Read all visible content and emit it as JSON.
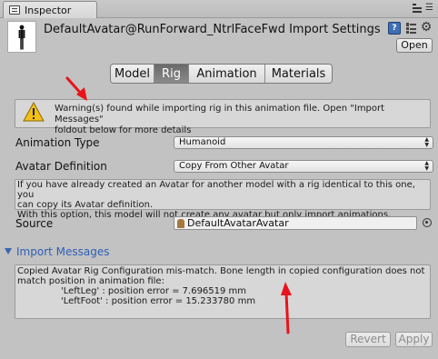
{
  "tab": {
    "title": "Inspector",
    "icon": "inspector-icon"
  },
  "header": {
    "title": "DefaultAvatar@RunForward_NtrlFaceFwd Import Settings",
    "open_label": "Open",
    "icons": [
      "help-book-icon",
      "preset-icon",
      "gear-icon"
    ]
  },
  "toolbar": {
    "tabs": [
      "Model",
      "Rig",
      "Animation",
      "Materials"
    ],
    "active_tab": "Rig"
  },
  "warning": {
    "line1": "Warning(s) found while importing rig in this animation file. Open \"Import Messages\"",
    "line2": "foldout below for more details"
  },
  "rig": {
    "animation_type_label": "Animation Type",
    "animation_type_value": "Humanoid",
    "avatar_definition_label": "Avatar Definition",
    "avatar_definition_value": "Copy From Other Avatar",
    "info_line1": "If you have already created an Avatar for another model with a rig identical to this one, you",
    "info_line2": "can copy its Avatar definition.",
    "info_line3": "With this option, this model will not create any avatar but only import animations.",
    "source_label": "Source",
    "source_value": "DefaultAvatarAvatar"
  },
  "import_messages": {
    "label": "Import Messages",
    "line1": "Copied Avatar Rig Configuration mis-match. Bone length in copied configuration does not",
    "line2": "match position in animation file:",
    "line3": "'LeftLeg' : position error = 7.696519 mm",
    "line4": "'LeftFoot' : position error = 15.233780 mm"
  },
  "footer": {
    "revert_label": "Revert",
    "apply_label": "Apply"
  },
  "colors": {
    "arrow": "#e8141c",
    "foldout": "#2f5fb3",
    "active_tab": "#727272"
  }
}
